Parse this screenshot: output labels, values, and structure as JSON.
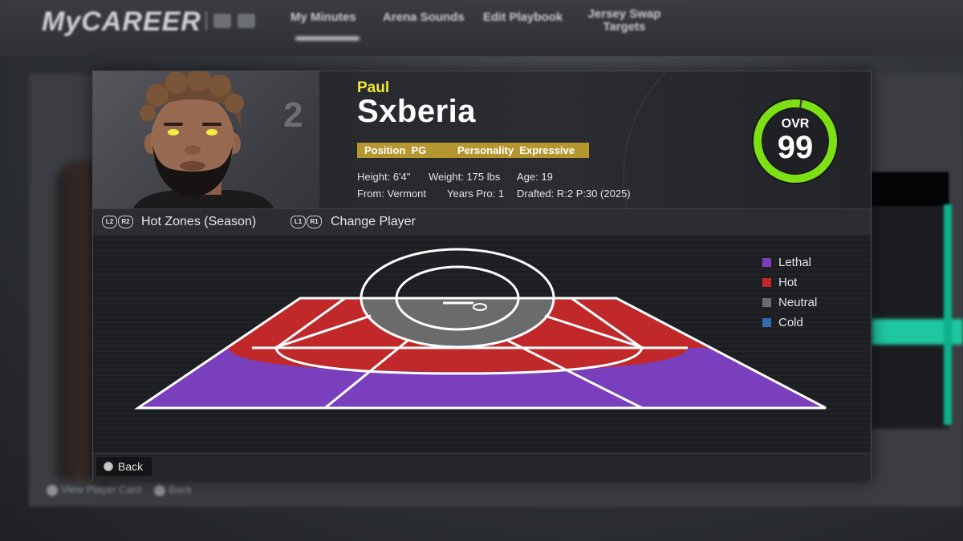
{
  "app": {
    "logo_text": "MyCAREER",
    "nav": [
      "My Minutes",
      "Arena Sounds",
      "Edit Playbook",
      "Jersey Swap Targets"
    ],
    "active_nav": "My Minutes",
    "bottom_hints": [
      "View Player Card",
      "Back"
    ]
  },
  "player": {
    "jersey_number": "2",
    "first_name": "Paul",
    "last_name": "Sxberia",
    "position_label": "Position",
    "position": "PG",
    "personality_label": "Personality",
    "personality": "Expressive",
    "height": "Height: 6'4\"",
    "weight": "Weight: 175 lbs",
    "age": "Age: 19",
    "from": "From: Vermont",
    "years_pro": "Years Pro: 1",
    "drafted": "Drafted: R:2 P:30 (2025)",
    "ovr_label": "OVR",
    "ovr": "99",
    "ovr_fraction": 0.99
  },
  "toolbar": {
    "hot_zones_buttons": [
      "L2",
      "R2"
    ],
    "hot_zones_label": "Hot Zones (Season)",
    "change_player_buttons": [
      "L1",
      "R1"
    ],
    "change_player_label": "Change Player"
  },
  "hot_zones": {
    "zones": [
      {
        "zone": "left-corner-three",
        "rating": "Hot"
      },
      {
        "zone": "left-wing-three",
        "rating": "Hot"
      },
      {
        "zone": "left-elbow-mid",
        "rating": "Hot"
      },
      {
        "zone": "left-baseline-mid",
        "rating": "Hot"
      },
      {
        "zone": "top-of-key-mid",
        "rating": "Hot"
      },
      {
        "zone": "right-elbow-mid",
        "rating": "Hot"
      },
      {
        "zone": "right-baseline-mid",
        "rating": "Hot"
      },
      {
        "zone": "right-wing-three",
        "rating": "Hot"
      },
      {
        "zone": "right-corner-three",
        "rating": "Hot"
      },
      {
        "zone": "short-mid-range",
        "rating": "Neutral"
      },
      {
        "zone": "paint",
        "rating": "Neutral"
      },
      {
        "zone": "left-deep-three",
        "rating": "Lethal"
      },
      {
        "zone": "center-deep-three",
        "rating": "Lethal"
      },
      {
        "zone": "right-deep-three",
        "rating": "Lethal"
      }
    ],
    "legend": [
      {
        "label": "Lethal",
        "color": "#7a3fbd"
      },
      {
        "label": "Hot",
        "color": "#c0282a"
      },
      {
        "label": "Neutral",
        "color": "#6b6b6b"
      },
      {
        "label": "Cold",
        "color": "#2f6cb3"
      }
    ]
  },
  "colors": {
    "accent_yellow": "#f2e830",
    "badge_gold": "#b5962f",
    "ovr_ring": "#7de012",
    "teal_accent": "#1fc7a0"
  },
  "footer": {
    "back_label": "Back"
  }
}
